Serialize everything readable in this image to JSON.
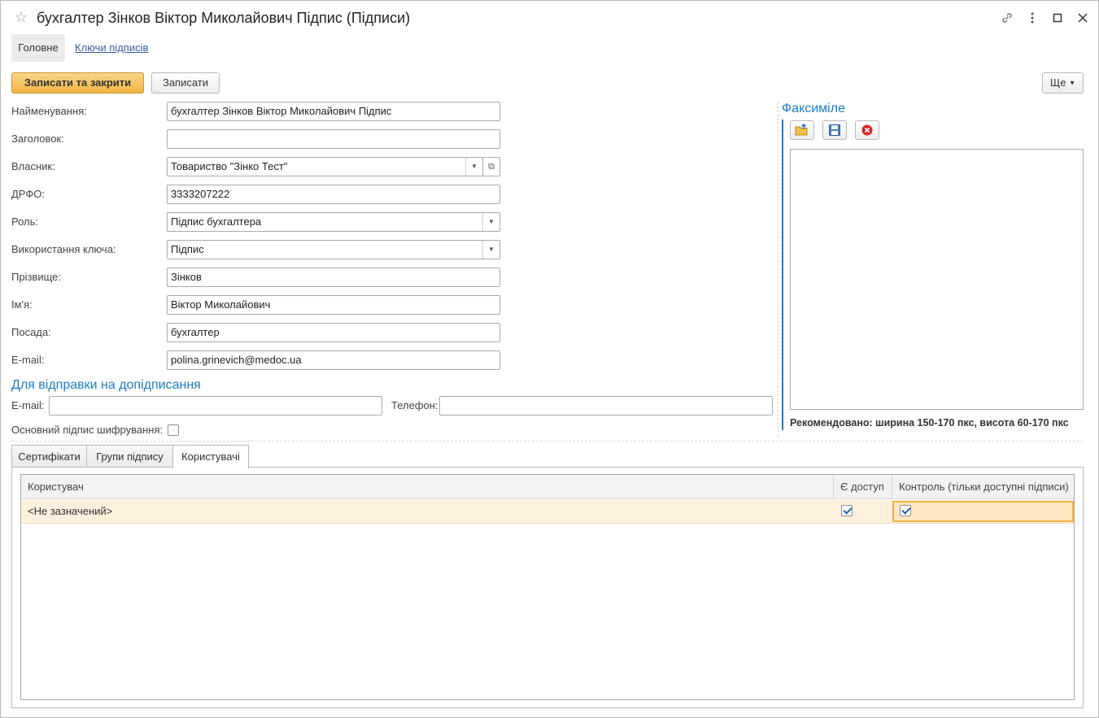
{
  "window": {
    "title": "бухгалтер Зінков Віктор Миколайович Підпис (Підписи)",
    "title_icons": [
      "star-icon",
      "link-icon",
      "more-icon",
      "maximize-icon",
      "close-icon"
    ]
  },
  "nav": {
    "main": "Головне",
    "keys": "Ключи підписів"
  },
  "toolbar": {
    "save_close": "Записати та закрити",
    "save": "Записати",
    "more": "Ще"
  },
  "form": {
    "name_label": "Найменування:",
    "name_value": "бухгалтер Зінков Віктор Миколайович Підпис",
    "header_label": "Заголовок:",
    "header_value": "",
    "owner_label": "Власник:",
    "owner_value": "Товариство \"Зінко Тест\"",
    "drfo_label": "ДРФО:",
    "drfo_value": "3333207222",
    "role_label": "Роль:",
    "role_value": "Підпис бухгалтера",
    "key_usage_label": "Використання ключа:",
    "key_usage_value": "Підпис",
    "surname_label": "Прізвище:",
    "surname_value": "Зінков",
    "firstname_label": "Ім'я:",
    "firstname_value": "Віктор Миколайович",
    "position_label": "Посада:",
    "position_value": "бухгалтер",
    "email_label": "E-mail:",
    "email_value": "polina.grinevich@medoc.ua"
  },
  "resend": {
    "title": "Для відправки на допідписання",
    "email_label": "E-mail:",
    "email_value": "",
    "phone_label": "Телефон:",
    "phone_value": ""
  },
  "main_encryption": {
    "label": "Основний підпис шифрування:",
    "checked": false
  },
  "facsimile": {
    "title": "Факсиміле",
    "recommendation": "Рекомендовано: ширина 150-170 пкс, висота 60-170 пкс"
  },
  "tabs": [
    {
      "label": "Сертифікати",
      "active": false
    },
    {
      "label": "Групи підпису",
      "active": false
    },
    {
      "label": "Користувачі",
      "active": true
    }
  ],
  "users_table": {
    "columns": [
      "Користувач",
      "Є доступ",
      "Контроль (тільки доступні підписи)"
    ],
    "rows": [
      {
        "user": "<Не зазначений>",
        "access": true,
        "control": true
      }
    ]
  },
  "colors": {
    "accent_blue": "#1c7cc1",
    "primary_button": "#f2b540",
    "selected_row": "#fdf0dd",
    "link": "#3a5ea3"
  }
}
